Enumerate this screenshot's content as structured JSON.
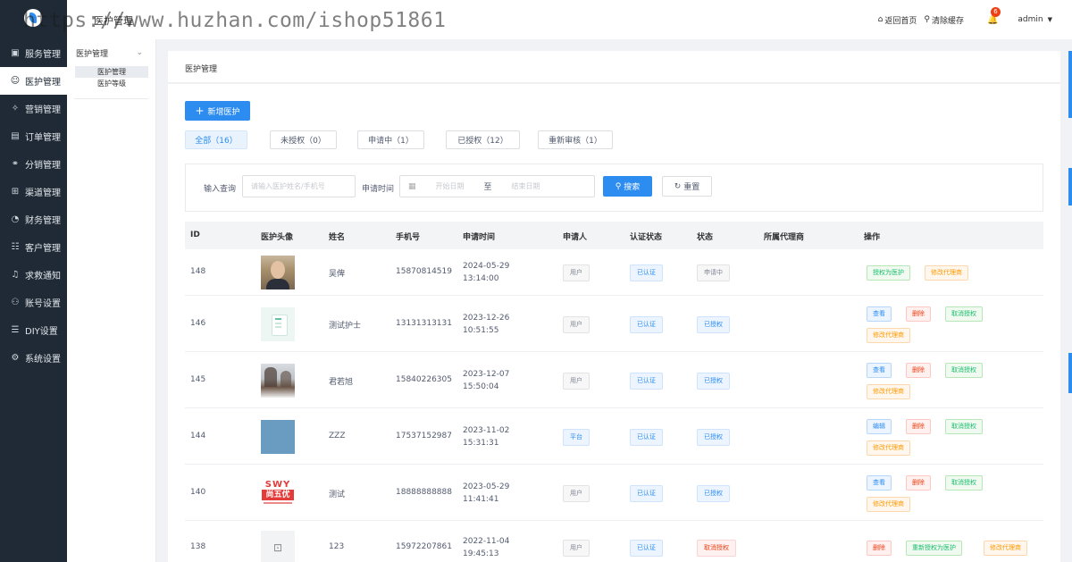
{
  "header": {
    "title": "医护管理",
    "links": [
      {
        "icon": "home-icon",
        "label": "返回首页"
      },
      {
        "icon": "broom-icon",
        "label": "清除缓存"
      }
    ],
    "notification_count": "6",
    "username": "admin",
    "watermark": "https://www.huzhan.com/ishop51861"
  },
  "sidebar": {
    "items": [
      {
        "icon": "service-icon",
        "label": "服务管理"
      },
      {
        "icon": "user-icon",
        "label": "医护管理"
      },
      {
        "icon": "marketing-icon",
        "label": "营销管理"
      },
      {
        "icon": "order-icon",
        "label": "订单管理"
      },
      {
        "icon": "distribution-icon",
        "label": "分销管理"
      },
      {
        "icon": "channel-icon",
        "label": "渠道管理"
      },
      {
        "icon": "finance-icon",
        "label": "财务管理"
      },
      {
        "icon": "customer-icon",
        "label": "客户管理"
      },
      {
        "icon": "bell-icon",
        "label": "求救通知"
      },
      {
        "icon": "account-icon",
        "label": "账号设置"
      },
      {
        "icon": "diy-icon",
        "label": "DIY设置"
      },
      {
        "icon": "settings-icon",
        "label": "系统设置"
      }
    ]
  },
  "subnav": {
    "group_label": "医护管理",
    "items": [
      "医护管理",
      "医护等级"
    ]
  },
  "page": {
    "title": "医护管理",
    "add_button": "新增医护",
    "tabs": [
      "全部（16）",
      "未授权（0）",
      "申请中（1）",
      "已授权（12）",
      "重新审核（1）"
    ],
    "search": {
      "query_label": "输入查询",
      "query_placeholder": "请输入医护姓名/手机号",
      "date_label": "申请时间",
      "start_placeholder": "开始日期",
      "date_separator": "至",
      "end_placeholder": "结束日期",
      "search_button": "搜索",
      "reset_button": "重置"
    }
  },
  "table": {
    "columns": [
      "ID",
      "医护头像",
      "姓名",
      "手机号",
      "申请时间",
      "申请人",
      "认证状态",
      "状态",
      "所属代理商",
      "操作"
    ],
    "rows": [
      {
        "id": "148",
        "avatar": "person",
        "name": "吴俾",
        "phone": "15870814519",
        "date": "2024-05-29",
        "time": "13:14:00",
        "applicant": "用户",
        "applicant_color": "gray",
        "cert": "已认证",
        "status": "申请中",
        "status_color": "gray",
        "agent": "",
        "ops": [
          {
            "label": "授权为医护",
            "color": "green"
          },
          {
            "label": "修改代理商",
            "color": "orange"
          }
        ]
      },
      {
        "id": "146",
        "avatar": "doc",
        "name": "测试护士",
        "phone": "13131313131",
        "date": "2023-12-26",
        "time": "10:51:55",
        "applicant": "用户",
        "applicant_color": "gray",
        "cert": "已认证",
        "status": "已授权",
        "status_color": "blue",
        "agent": "",
        "ops": [
          {
            "label": "查看",
            "color": "blue"
          },
          {
            "label": "删除",
            "color": "red"
          },
          {
            "label": "取消授权",
            "color": "green"
          },
          {
            "label": "修改代理商",
            "color": "orange"
          }
        ]
      },
      {
        "id": "145",
        "avatar": "snow",
        "name": "君若旭",
        "phone": "15840226305",
        "date": "2023-12-07",
        "time": "15:50:04",
        "applicant": "用户",
        "applicant_color": "gray",
        "cert": "已认证",
        "status": "已授权",
        "status_color": "blue",
        "agent": "",
        "ops": [
          {
            "label": "查看",
            "color": "blue"
          },
          {
            "label": "删除",
            "color": "red"
          },
          {
            "label": "取消授权",
            "color": "green"
          },
          {
            "label": "修改代理商",
            "color": "orange"
          }
        ]
      },
      {
        "id": "144",
        "avatar": "blue",
        "name": "ZZZ",
        "phone": "17537152987",
        "date": "2023-11-02",
        "time": "15:31:31",
        "applicant": "平台",
        "applicant_color": "blue",
        "cert": "已认证",
        "status": "已授权",
        "status_color": "blue",
        "agent": "",
        "ops": [
          {
            "label": "编辑",
            "color": "blue"
          },
          {
            "label": "删除",
            "color": "red"
          },
          {
            "label": "取消授权",
            "color": "green"
          },
          {
            "label": "修改代理商",
            "color": "orange"
          }
        ]
      },
      {
        "id": "140",
        "avatar": "logo",
        "name": "测试",
        "phone": "18888888888",
        "date": "2023-05-29",
        "time": "11:41:41",
        "applicant": "用户",
        "applicant_color": "gray",
        "cert": "已认证",
        "status": "已授权",
        "status_color": "blue",
        "agent": "",
        "ops": [
          {
            "label": "查看",
            "color": "blue"
          },
          {
            "label": "删除",
            "color": "red"
          },
          {
            "label": "取消授权",
            "color": "green"
          },
          {
            "label": "修改代理商",
            "color": "orange"
          }
        ]
      },
      {
        "id": "138",
        "avatar": "placeholder",
        "name": "123",
        "phone": "15972207861",
        "date": "2022-11-04",
        "time": "19:45:13",
        "applicant": "用户",
        "applicant_color": "gray",
        "cert": "已认证",
        "status": "取消授权",
        "status_color": "red",
        "agent": "",
        "ops": [
          {
            "label": "删除",
            "color": "red"
          },
          {
            "label": "重新授权为医护",
            "color": "green"
          },
          {
            "label": "修改代理商",
            "color": "orange"
          }
        ]
      }
    ],
    "logo_avatar_text": {
      "top": "SWY",
      "middle": "尚五优"
    }
  },
  "colors": {
    "primary": "#2d8cf0",
    "sidebar_bg": "#1f2a36",
    "success": "#19be6b",
    "warning": "#ff9900",
    "danger": "#ed4014"
  }
}
